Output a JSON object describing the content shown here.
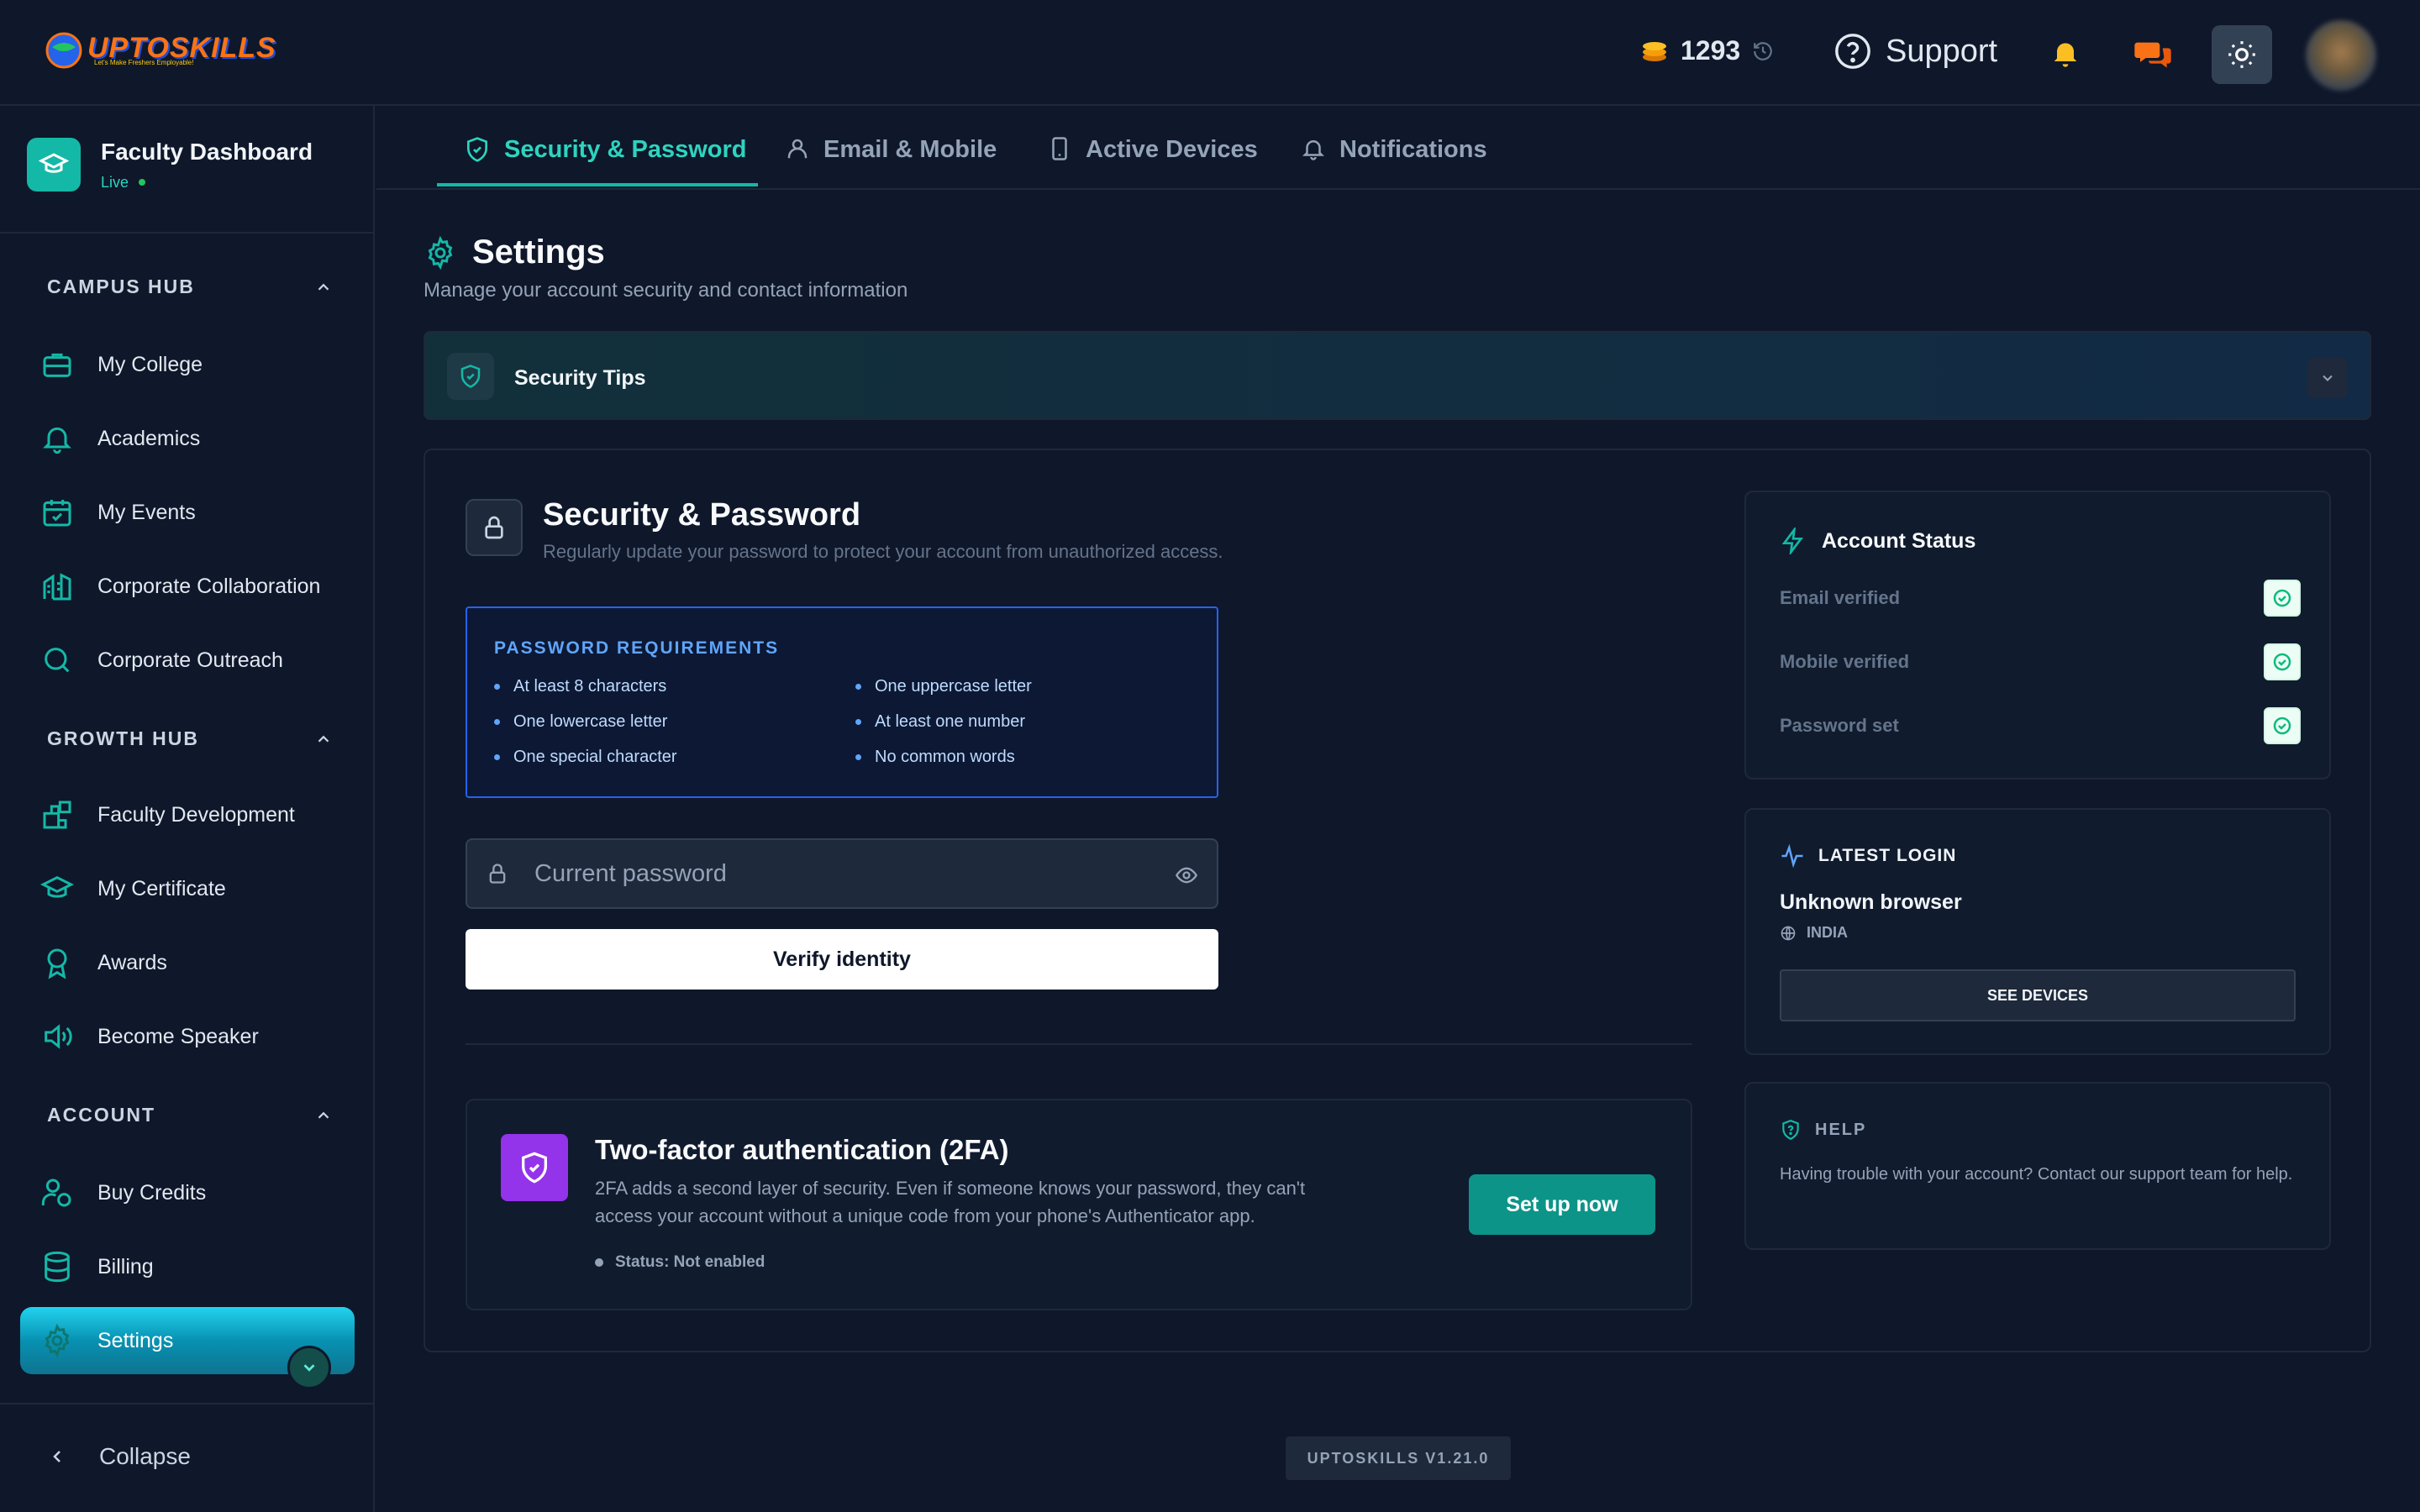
{
  "header": {
    "coins": "1293",
    "support_label": "Support",
    "logo_text": "UPTOSKILLS",
    "logo_tagline": "Let's Make Freshers Employable!"
  },
  "sidebar": {
    "dashboard_title": "Faculty Dashboard",
    "dashboard_status": "Live",
    "sections": [
      {
        "title": "CAMPUS HUB",
        "items": [
          {
            "label": "My College",
            "icon": "briefcase-icon"
          },
          {
            "label": "Academics",
            "icon": "bell-icon"
          },
          {
            "label": "My Events",
            "icon": "calendar-check-icon"
          },
          {
            "label": "Corporate Collaboration",
            "icon": "building-icon"
          },
          {
            "label": "Corporate Outreach",
            "icon": "search-icon"
          }
        ]
      },
      {
        "title": "GROWTH HUB",
        "items": [
          {
            "label": "Faculty Development",
            "icon": "blocks-icon"
          },
          {
            "label": "My Certificate",
            "icon": "graduation-cap-icon"
          },
          {
            "label": "Awards",
            "icon": "award-icon"
          },
          {
            "label": "Become Speaker",
            "icon": "speaker-icon"
          }
        ]
      },
      {
        "title": "ACCOUNT",
        "items": [
          {
            "label": "Buy Credits",
            "icon": "user-coins-icon"
          },
          {
            "label": "Billing",
            "icon": "database-icon"
          },
          {
            "label": "Settings",
            "icon": "gear-icon",
            "active": true
          }
        ]
      }
    ],
    "collapse_label": "Collapse"
  },
  "tabs": [
    {
      "label": "Security & Password",
      "icon": "shield-check-icon",
      "active": true
    },
    {
      "label": "Email & Mobile",
      "icon": "user-icon"
    },
    {
      "label": "Active Devices",
      "icon": "smartphone-icon"
    },
    {
      "label": "Notifications",
      "icon": "bell-icon"
    }
  ],
  "page": {
    "title": "Settings",
    "subtitle": "Manage your account security and contact information",
    "security_tips_label": "Security Tips"
  },
  "security": {
    "title": "Security & Password",
    "subtitle": "Regularly update your password to protect your account from unauthorized access.",
    "requirements_title": "PASSWORD REQUIREMENTS",
    "requirements": [
      "At least 8 characters",
      "One uppercase letter",
      "One lowercase letter",
      "At least one number",
      "One special character",
      "No common words"
    ],
    "current_password_placeholder": "Current password",
    "verify_label": "Verify identity"
  },
  "two_factor": {
    "title": "Two-factor authentication (2FA)",
    "description": "2FA adds a second layer of security. Even if someone knows your password, they can't access your account without a unique code from your phone's Authenticator app.",
    "status": "Status: Not enabled",
    "setup_label": "Set up now"
  },
  "account_status": {
    "title": "Account Status",
    "rows": [
      "Email verified",
      "Mobile verified",
      "Password set"
    ]
  },
  "latest_login": {
    "title": "LATEST LOGIN",
    "browser": "Unknown browser",
    "location": "INDIA",
    "see_devices_label": "SEE DEVICES"
  },
  "help": {
    "title": "HELP",
    "text": "Having trouble with your account? Contact our support team for help."
  },
  "footer": {
    "version": "UPTOSKILLS V1.21.0"
  },
  "colors": {
    "accent": "#14b8a6",
    "background": "#0f172a",
    "purple": "#9333ea",
    "blue": "#2563eb"
  }
}
